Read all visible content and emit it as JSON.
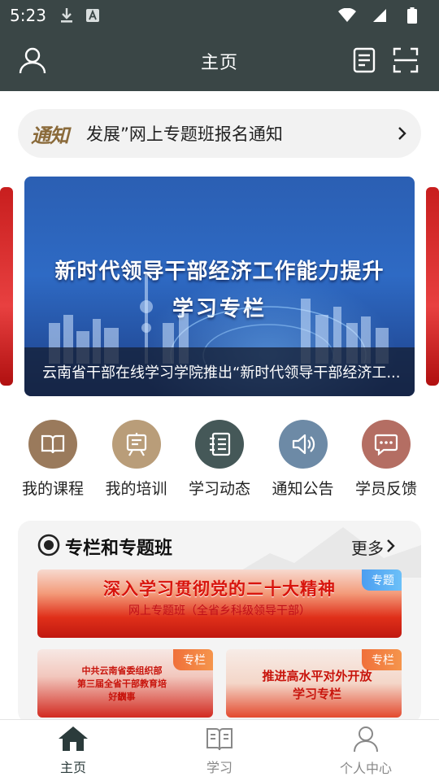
{
  "status_bar": {
    "time": "5:23",
    "icons": [
      "download-icon",
      "a-icon",
      "wifi-icon",
      "signal-icon",
      "battery-icon"
    ]
  },
  "app_bar": {
    "title": "主页",
    "icons": [
      "user-icon",
      "document-icon",
      "scan-icon"
    ]
  },
  "notice": {
    "tag": "通知",
    "text": "发展”网上专题班报名通知"
  },
  "banner": {
    "headline_line1": "新时代领导干部经济工作能力提升",
    "headline_line2": "学习专栏",
    "caption": "云南省干部在线学习学院推出“新时代领导干部经济工..."
  },
  "quick_menu": [
    {
      "label": "我的课程",
      "icon": "book-icon",
      "color": "#9a7a5c"
    },
    {
      "label": "我的培训",
      "icon": "training-board-icon",
      "color": "#b99d79"
    },
    {
      "label": "学习动态",
      "icon": "notebook-icon",
      "color": "#455858"
    },
    {
      "label": "通知公告",
      "icon": "speaker-icon",
      "color": "#6d8aa6"
    },
    {
      "label": "学员反馈",
      "icon": "chat-icon",
      "color": "#b46e63"
    }
  ],
  "section": {
    "title": "专栏和专题班",
    "more_label": "更多",
    "cards": [
      {
        "badge": "专题",
        "line1": "深入学习贯彻党的二十大精神",
        "line2": "网上专题班（全省乡科级领导干部）"
      },
      {
        "badge": "专栏",
        "line1": "中共云南省委组织部",
        "line2": "第三届全省干部教育培训",
        "line3": "好故事"
      },
      {
        "badge": "专栏",
        "line1": "推进高水平对外开放",
        "line2": "学习专栏"
      }
    ]
  },
  "bottom_nav": [
    {
      "label": "主页",
      "icon": "home-icon",
      "active": true
    },
    {
      "label": "学习",
      "icon": "open-book-icon",
      "active": false
    },
    {
      "label": "个人中心",
      "icon": "person-icon",
      "active": false
    }
  ],
  "colors": {
    "header_bg": "#3a4646",
    "notice_bg": "#f2f2f2",
    "active_tab": "#2b3b3b"
  }
}
